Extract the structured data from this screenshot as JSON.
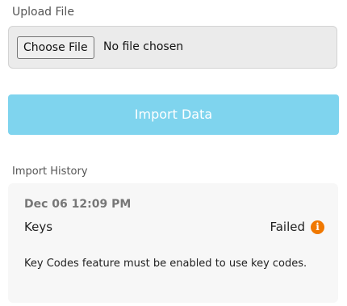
{
  "upload": {
    "label": "Upload File",
    "choose_button": "Choose File",
    "file_status": "No file chosen"
  },
  "import_button": {
    "label": "Import Data",
    "color": "#7fd4ee"
  },
  "history": {
    "label": "Import History",
    "entries": [
      {
        "date": "Dec 06 12:09 PM",
        "name": "Keys",
        "status": "Failed",
        "status_icon": "info-icon",
        "status_icon_color": "#f07800",
        "message": "Key Codes feature must be enabled to use key codes."
      }
    ]
  }
}
